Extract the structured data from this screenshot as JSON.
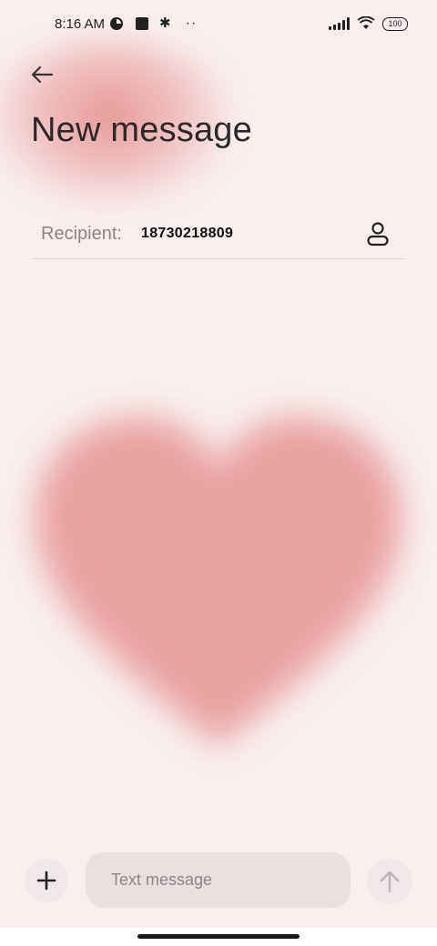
{
  "status_bar": {
    "time": "8:16 AM",
    "battery": "100",
    "left_icons": [
      "vpn-icon",
      "square-notification-icon",
      "settings-gear-icon",
      "more-dots-icon"
    ],
    "right_icons": [
      "signal-icon",
      "wifi-icon",
      "battery-icon"
    ]
  },
  "header": {
    "back_icon": "back-arrow-icon",
    "title": "New message"
  },
  "recipient": {
    "label": "Recipient:",
    "value": "18730218809",
    "contact_icon": "contact-person-icon"
  },
  "composer": {
    "add_icon": "plus-icon",
    "placeholder": "Text message",
    "send_icon": "arrow-up-icon"
  },
  "colors": {
    "background": "#f8eeee",
    "heart": "#e8a0a0",
    "text_primary": "#2a2a2a",
    "text_secondary": "#8c8484"
  }
}
